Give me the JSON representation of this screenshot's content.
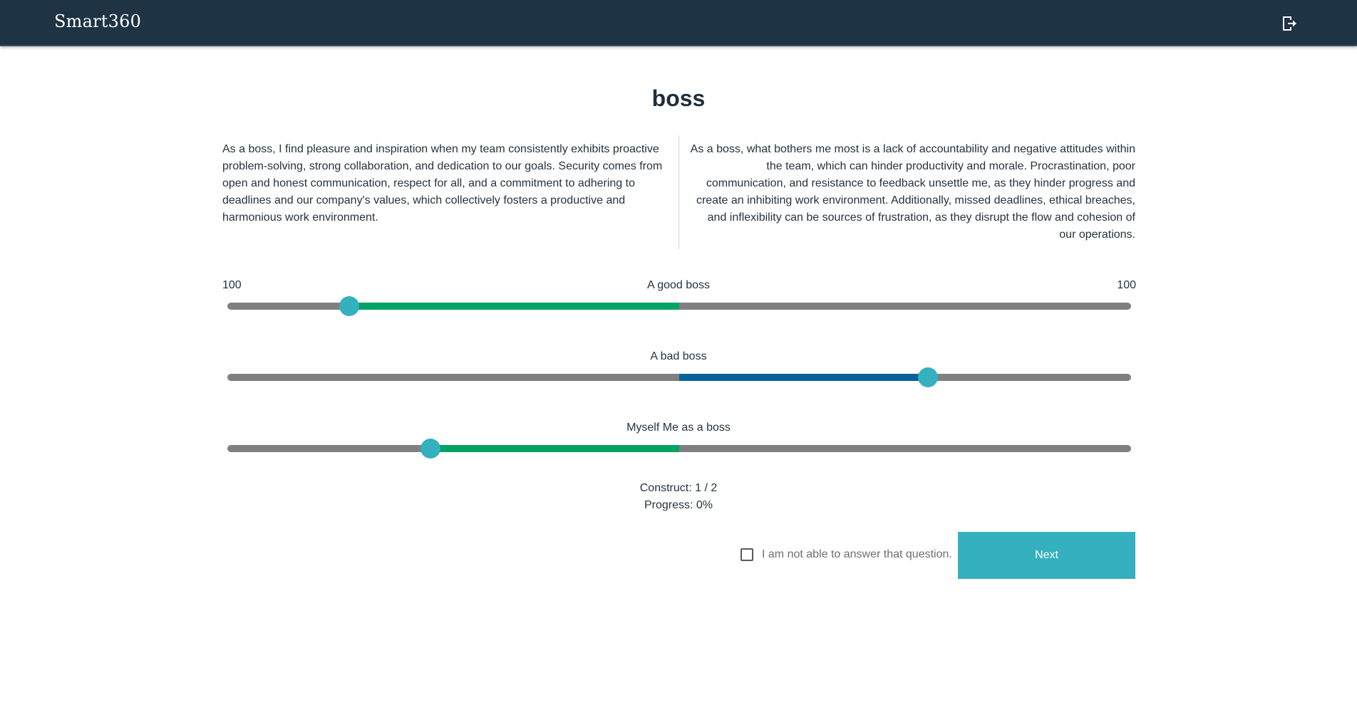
{
  "app": {
    "brand": "Smart360",
    "logout_icon": "logout-icon"
  },
  "page": {
    "title": "boss",
    "description_left": "As a boss, I find pleasure and inspiration when my team consistently exhibits proactive problem-solving, strong collaboration, and dedication to our goals. Security comes from open and honest communication, respect for all, and a commitment to adhering to deadlines and our company's values, which collectively fosters a productive and harmonious work environment.",
    "description_right": "As a boss, what bothers me most is a lack of accountability and negative attitudes within the team, which can hinder productivity and morale. Procrastination, poor communication, and resistance to feedback unsettle me, as they hinder progress and create an inhibiting work environment. Additionally, missed deadlines, ethical breaches, and inflexibility can be sources of frustration, as they disrupt the flow and cohesion of our operations."
  },
  "scale": {
    "left_label": "100",
    "right_label": "100"
  },
  "sliders": [
    {
      "label": "A good boss",
      "value": -73,
      "min": -100,
      "max": 100,
      "fill_color": "#00a362"
    },
    {
      "label": "A bad boss",
      "value": 55,
      "min": -100,
      "max": 100,
      "fill_color": "#0a6198"
    },
    {
      "label": "Myself Me as a boss",
      "value": -55,
      "min": -100,
      "max": 100,
      "fill_color": "#00a362"
    }
  ],
  "status": {
    "construct": "Construct: 1 / 2",
    "progress": "Progress: 0%"
  },
  "actions": {
    "not_able_label": "I am not able to answer that question.",
    "not_able_checked": false,
    "next_label": "Next"
  },
  "colors": {
    "header_bg": "#1e3344",
    "accent": "#34b0be",
    "track": "#808080"
  }
}
